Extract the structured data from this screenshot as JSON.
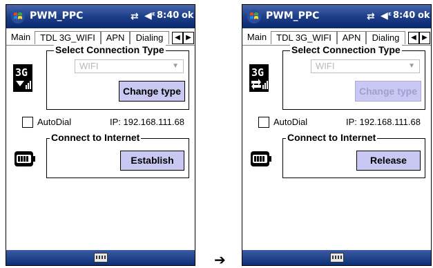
{
  "left": {
    "app_title": "PWM_PPC",
    "clock": "8:40",
    "ok": "ok",
    "tabs": [
      "Main",
      "TDL 3G_WIFI",
      "APN",
      "Dialing"
    ],
    "select_group_title": "Select Connection Type",
    "select_value": "WIFI",
    "change_type_button": "Change type",
    "change_type_enabled": true,
    "autodial_label": "AutoDial",
    "autodial_checked": false,
    "ip_label": "IP: 192.168.111.68",
    "connect_group_title": "Connect to Internet",
    "connect_button": "Establish"
  },
  "right": {
    "app_title": "PWM_PPC",
    "clock": "8:40",
    "ok": "ok",
    "tabs": [
      "Main",
      "TDL 3G_WIFI",
      "APN",
      "Dialing"
    ],
    "select_group_title": "Select Connection Type",
    "select_value": "WIFI",
    "change_type_button": "Change type",
    "change_type_enabled": false,
    "autodial_label": "AutoDial",
    "autodial_checked": false,
    "ip_label": "IP: 192.168.111.68",
    "connect_group_title": "Connect to Internet",
    "connect_button": "Release"
  },
  "transition_arrow": "➔",
  "icons": {
    "start": "windows-flag-icon",
    "signal": "connectivity-icon",
    "volume": "speaker-icon",
    "mode": "3g-icon",
    "battery": "battery-icon",
    "keyboard": "keyboard-icon"
  }
}
